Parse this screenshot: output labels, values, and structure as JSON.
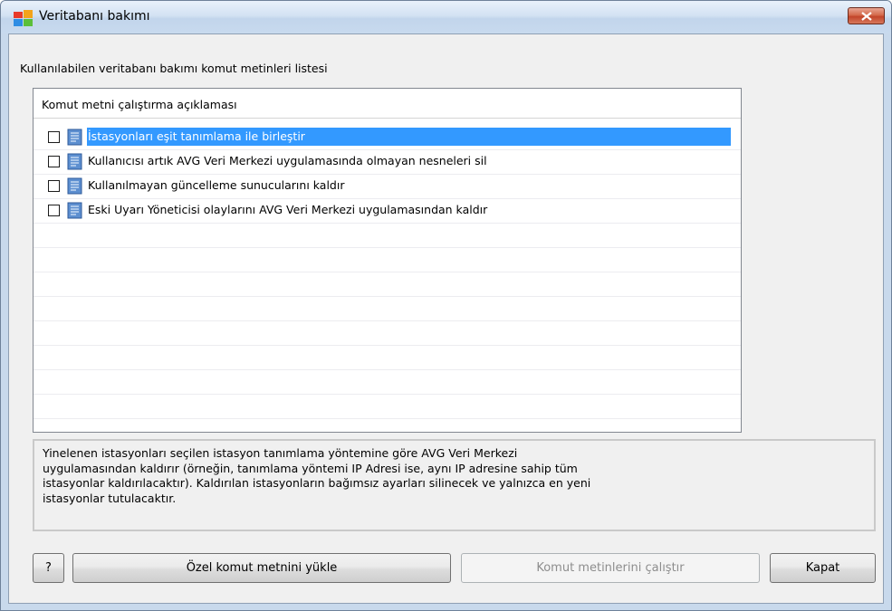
{
  "window": {
    "title": "Veritabanı bakımı",
    "icon": "avg-app-icon",
    "close_icon": "close-icon"
  },
  "main": {
    "list_caption": "Kullanılabilen veritabanı bakımı komut metinleri listesi",
    "column_header": "Komut metni çalıştırma açıklaması",
    "items": [
      {
        "label": "İstasyonları eşit tanımlama ile birleştir",
        "checked": false,
        "selected": true
      },
      {
        "label": "Kullanıcısı artık AVG Veri Merkezi uygulamasında olmayan nesneleri sil",
        "checked": false,
        "selected": false
      },
      {
        "label": "Kullanılmayan güncelleme sunucularını kaldır",
        "checked": false,
        "selected": false
      },
      {
        "label": "Eski Uyarı Yöneticisi olaylarını AVG Veri Merkezi uygulamasından kaldır",
        "checked": false,
        "selected": false
      }
    ],
    "description_lines": [
      "Yinelenen istasyonları seçilen istasyon tanımlama yöntemine göre AVG Veri Merkezi",
      "uygulamasından kaldırır (örneğin, tanımlama yöntemi IP Adresi ise, aynı IP adresine sahip tüm",
      "istasyonlar kaldırılacaktır). Kaldırılan istasyonların bağımsız ayarları silinecek ve yalnızca en yeni",
      "istasyonlar tutulacaktır."
    ]
  },
  "buttons": {
    "help": "?",
    "load_custom": "Özel komut metnini yükle",
    "run_scripts": "Komut metinlerini çalıştır",
    "close": "Kapat"
  },
  "colors": {
    "selection": "#3399ff",
    "titlebar": "#c8d9ec",
    "close_button": "#c2452a"
  }
}
